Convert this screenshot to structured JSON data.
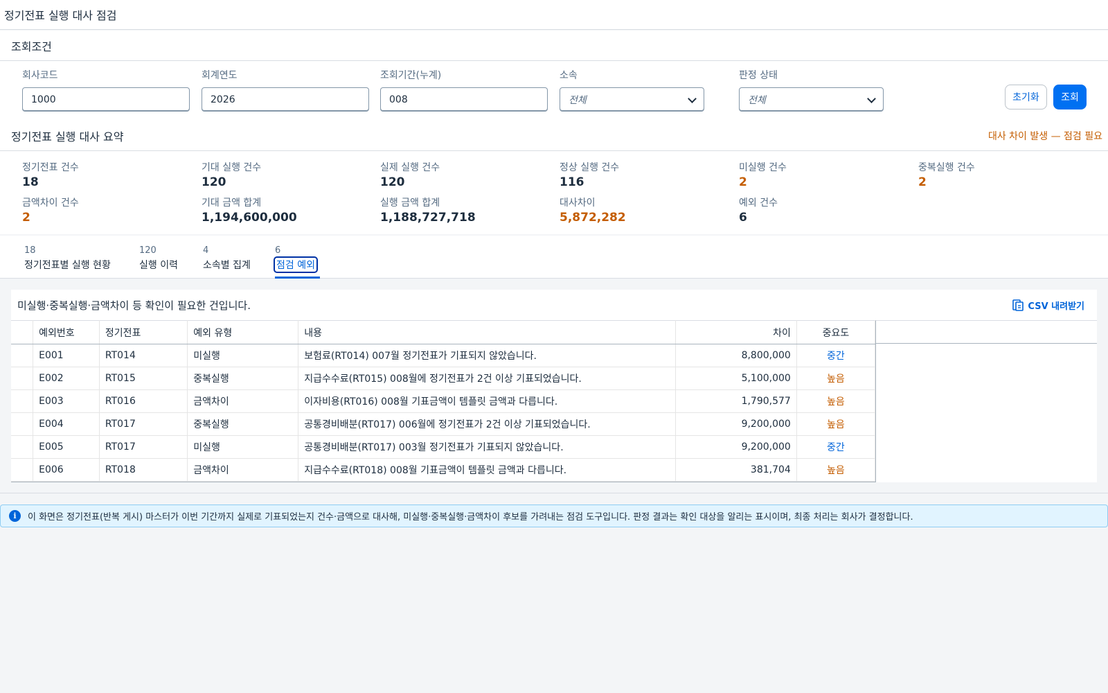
{
  "page": {
    "title": "정기전표 실행 대사 점검"
  },
  "filters": {
    "section_title": "조회조건",
    "company_code": {
      "label": "회사코드",
      "value": "1000"
    },
    "fiscal_year": {
      "label": "회계연도",
      "value": "2026"
    },
    "period": {
      "label": "조회기간(누계)",
      "value": "008"
    },
    "org": {
      "label": "소속",
      "placeholder": "전체"
    },
    "status": {
      "label": "판정 상태",
      "placeholder": "전체"
    },
    "reset_label": "초기화",
    "search_label": "조회"
  },
  "summary": {
    "title": "정기전표 실행 대사 요약",
    "warning": "대사 차이 발생 — 점검 필요",
    "kpis": [
      {
        "label": "정기전표 건수",
        "value": "18"
      },
      {
        "label": "기대 실행 건수",
        "value": "120"
      },
      {
        "label": "실제 실행 건수",
        "value": "120"
      },
      {
        "label": "정상 실행 건수",
        "value": "116"
      },
      {
        "label": "미실행 건수",
        "value": "2"
      },
      {
        "label": "중복실행 건수",
        "value": "2"
      },
      {
        "label": "금액차이 건수",
        "value": "2"
      },
      {
        "label": "기대 금액 합계",
        "value": "1,194,600,000"
      },
      {
        "label": "실행 금액 합계",
        "value": "1,188,727,718"
      },
      {
        "label": "대사차이",
        "value": "5,872,282"
      },
      {
        "label": "예외 건수",
        "value": "6"
      }
    ]
  },
  "tabs": [
    {
      "count": "18",
      "label": "정기전표별 실행 현황"
    },
    {
      "count": "120",
      "label": "실행 이력"
    },
    {
      "count": "4",
      "label": "소속별 집계"
    },
    {
      "count": "6",
      "label": "점검 예외"
    }
  ],
  "exceptions": {
    "description": "미실행·중복실행·금액차이 등 확인이 필요한 건입니다.",
    "csv_label": "CSV 내려받기",
    "columns": [
      "예외번호",
      "정기전표",
      "예외 유형",
      "내용",
      "차이",
      "중요도"
    ],
    "rows": [
      {
        "id": "E001",
        "rt": "RT014",
        "type": "미실행",
        "content": "보험료(RT014) 007월 정기전표가 기표되지 않았습니다.",
        "diff": "8,800,000",
        "severity": "중간"
      },
      {
        "id": "E002",
        "rt": "RT015",
        "type": "중복실행",
        "content": "지급수수료(RT015) 008월에 정기전표가 2건 이상 기표되었습니다.",
        "diff": "5,100,000",
        "severity": "높음"
      },
      {
        "id": "E003",
        "rt": "RT016",
        "type": "금액차이",
        "content": "이자비용(RT016) 008월 기표금액이 템플릿 금액과 다릅니다.",
        "diff": "1,790,577",
        "severity": "높음"
      },
      {
        "id": "E004",
        "rt": "RT017",
        "type": "중복실행",
        "content": "공통경비배분(RT017) 006월에 정기전표가 2건 이상 기표되었습니다.",
        "diff": "9,200,000",
        "severity": "높음"
      },
      {
        "id": "E005",
        "rt": "RT017",
        "type": "미실행",
        "content": "공통경비배분(RT017) 003월 정기전표가 기표되지 않았습니다.",
        "diff": "9,200,000",
        "severity": "중간"
      },
      {
        "id": "E006",
        "rt": "RT018",
        "type": "금액차이",
        "content": "지급수수료(RT018) 008월 기표금액이 템플릿 금액과 다릅니다.",
        "diff": "381,704",
        "severity": "높음"
      }
    ]
  },
  "info": {
    "text": "이 화면은 정기전표(반복 게시) 마스터가 이번 기간까지 실제로 기표되었는지 건수·금액으로 대사해, 미실행·중복실행·금액차이 후보를 가려내는 점검 도구입니다. 판정 결과는 확인 대상을 알리는 표시이며, 최종 처리는 회사가 결정합니다."
  },
  "colors": {
    "accent": "#0070f2",
    "warning": "#c45d00",
    "link": "#0064d9"
  },
  "icons": [
    "chevron-down-icon",
    "csv-download-icon",
    "info-icon"
  ]
}
